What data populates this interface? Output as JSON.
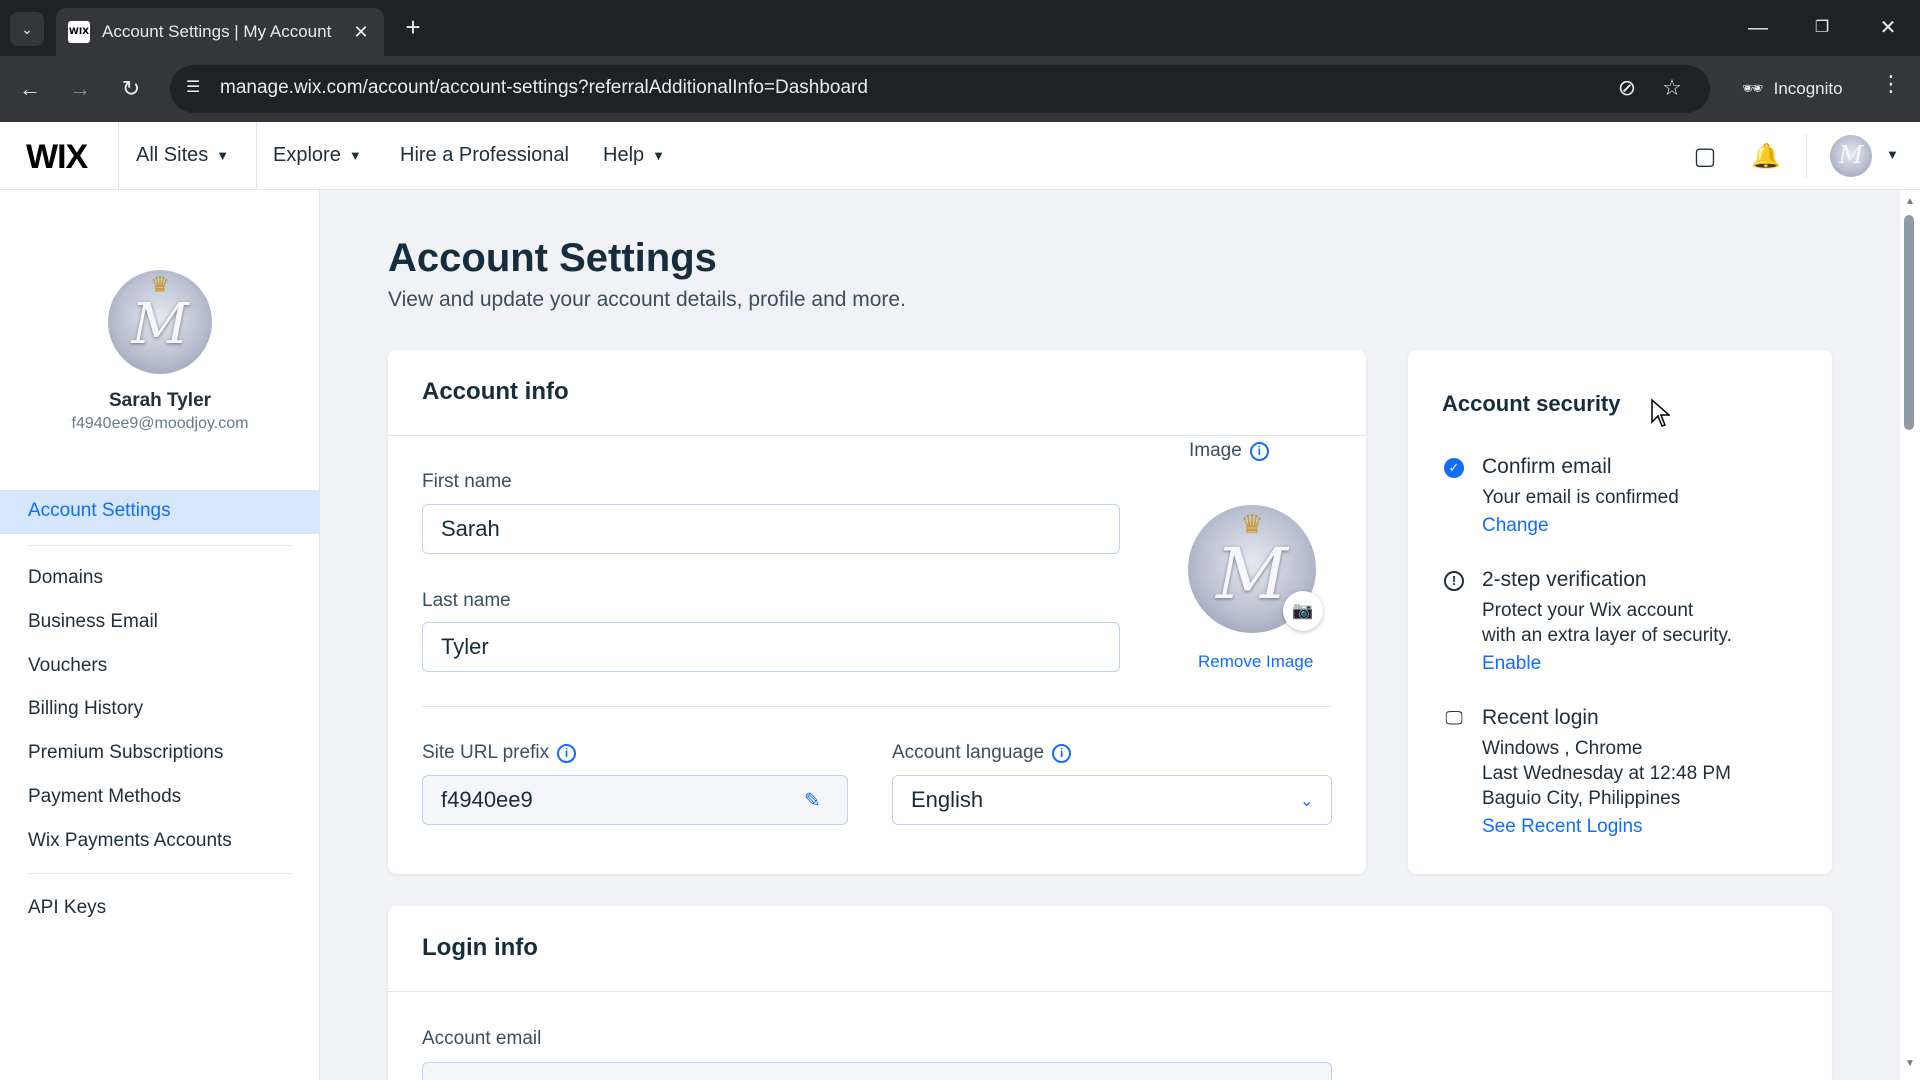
{
  "browser": {
    "tab_title": "Account Settings | My Account",
    "favicon_text": "WIX",
    "url": "manage.wix.com/account/account-settings?referralAdditionalInfo=Dashboard",
    "incognito_label": "Incognito"
  },
  "header": {
    "logo": "WIX",
    "nav": [
      {
        "label": "All Sites"
      },
      {
        "label": "Explore"
      },
      {
        "label": "Hire a Professional"
      },
      {
        "label": "Help"
      }
    ]
  },
  "sidebar": {
    "profile_name": "Sarah Tyler",
    "profile_email": "f4940ee9@moodjoy.com",
    "active_item": "Account Settings",
    "items": [
      {
        "label": "Domains"
      },
      {
        "label": "Business Email"
      },
      {
        "label": "Vouchers"
      },
      {
        "label": "Billing History"
      },
      {
        "label": "Premium Subscriptions"
      },
      {
        "label": "Payment Methods"
      },
      {
        "label": "Wix Payments Accounts"
      },
      {
        "label": "API Keys"
      }
    ]
  },
  "page": {
    "title": "Account Settings",
    "subtitle": "View and update your account details, profile and more."
  },
  "account_info": {
    "title": "Account info",
    "first_name_label": "First name",
    "first_name": "Sarah",
    "last_name_label": "Last name",
    "last_name": "Tyler",
    "image_label": "Image",
    "remove_image": "Remove Image",
    "site_url_label": "Site URL prefix",
    "site_url": "f4940ee9",
    "language_label": "Account language",
    "language": "English"
  },
  "account_security": {
    "title": "Account security",
    "confirm_email": {
      "heading": "Confirm email",
      "text": "Your email is confirmed",
      "link": "Change"
    },
    "two_step": {
      "heading": "2-step verification",
      "text_line1": "Protect your Wix account",
      "text_line2": "with an extra layer of security.",
      "link": "Enable"
    },
    "recent_login": {
      "heading": "Recent login",
      "device": "Windows , Chrome",
      "time": "Last Wednesday at 12:48 PM",
      "location": "Baguio City, Philippines",
      "link": "See Recent Logins"
    }
  },
  "login_info": {
    "title": "Login info",
    "account_email_label": "Account email"
  },
  "colors": {
    "accent": "#116dff",
    "active_bg": "#d6e6fe",
    "page_bg": "#f0f2f5"
  }
}
